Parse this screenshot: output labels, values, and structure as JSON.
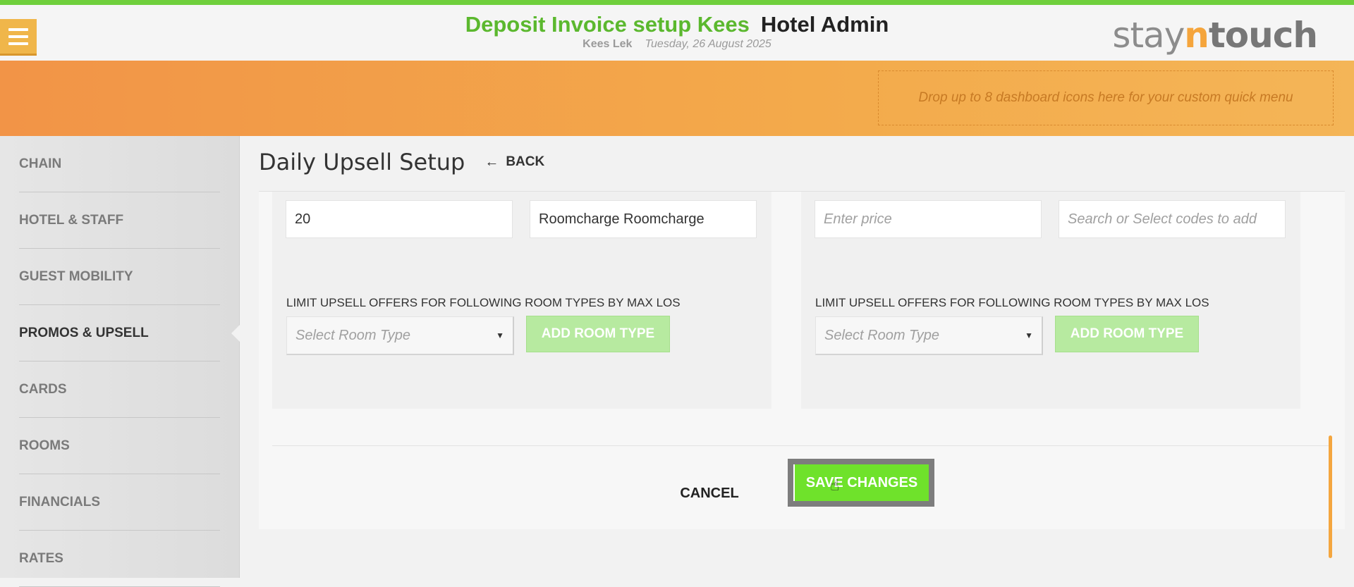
{
  "header": {
    "hotel_name": "Deposit Invoice setup Kees",
    "app_name": "Hotel Admin",
    "user": "Kees Lek",
    "date": "Tuesday, 26 August 2025",
    "logo": {
      "part1": "stay",
      "part2": "n",
      "part3": "touch"
    }
  },
  "banner": {
    "dropzone_text": "Drop up to 8 dashboard icons here for your custom quick menu"
  },
  "sidebar": {
    "items": [
      {
        "label": "CHAIN"
      },
      {
        "label": "HOTEL & STAFF"
      },
      {
        "label": "GUEST MOBILITY"
      },
      {
        "label": "PROMOS & UPSELL",
        "active": true
      },
      {
        "label": "CARDS"
      },
      {
        "label": "ROOMS"
      },
      {
        "label": "FINANCIALS"
      },
      {
        "label": "RATES"
      }
    ]
  },
  "page": {
    "title": "Daily Upsell Setup",
    "back_label": "BACK"
  },
  "left_card": {
    "price_value": "20",
    "codes_value": "Roomcharge Roomcharge",
    "limit_label": "LIMIT UPSELL OFFERS FOR FOLLOWING ROOM TYPES BY MAX LOS",
    "room_type_placeholder": "Select Room Type",
    "add_room_type_label": "ADD ROOM TYPE"
  },
  "right_card": {
    "price_placeholder": "Enter price",
    "codes_placeholder": "Search or Select codes to add",
    "limit_label": "LIMIT UPSELL OFFERS FOR FOLLOWING ROOM TYPES BY MAX LOS",
    "room_type_placeholder": "Select Room Type",
    "add_room_type_label": "ADD ROOM TYPE"
  },
  "actions": {
    "cancel_label": "CANCEL",
    "save_label": "SAVE CHANGES"
  },
  "colors": {
    "accent_green": "#6fe22b",
    "hotel_title_green": "#5bb82e",
    "banner_orange": "#f29447"
  },
  "icons": {
    "menu": "hamburger-icon",
    "back": "arrow-left-icon",
    "caret": "chevron-down-icon",
    "cursor": "hand-pointer-icon"
  }
}
